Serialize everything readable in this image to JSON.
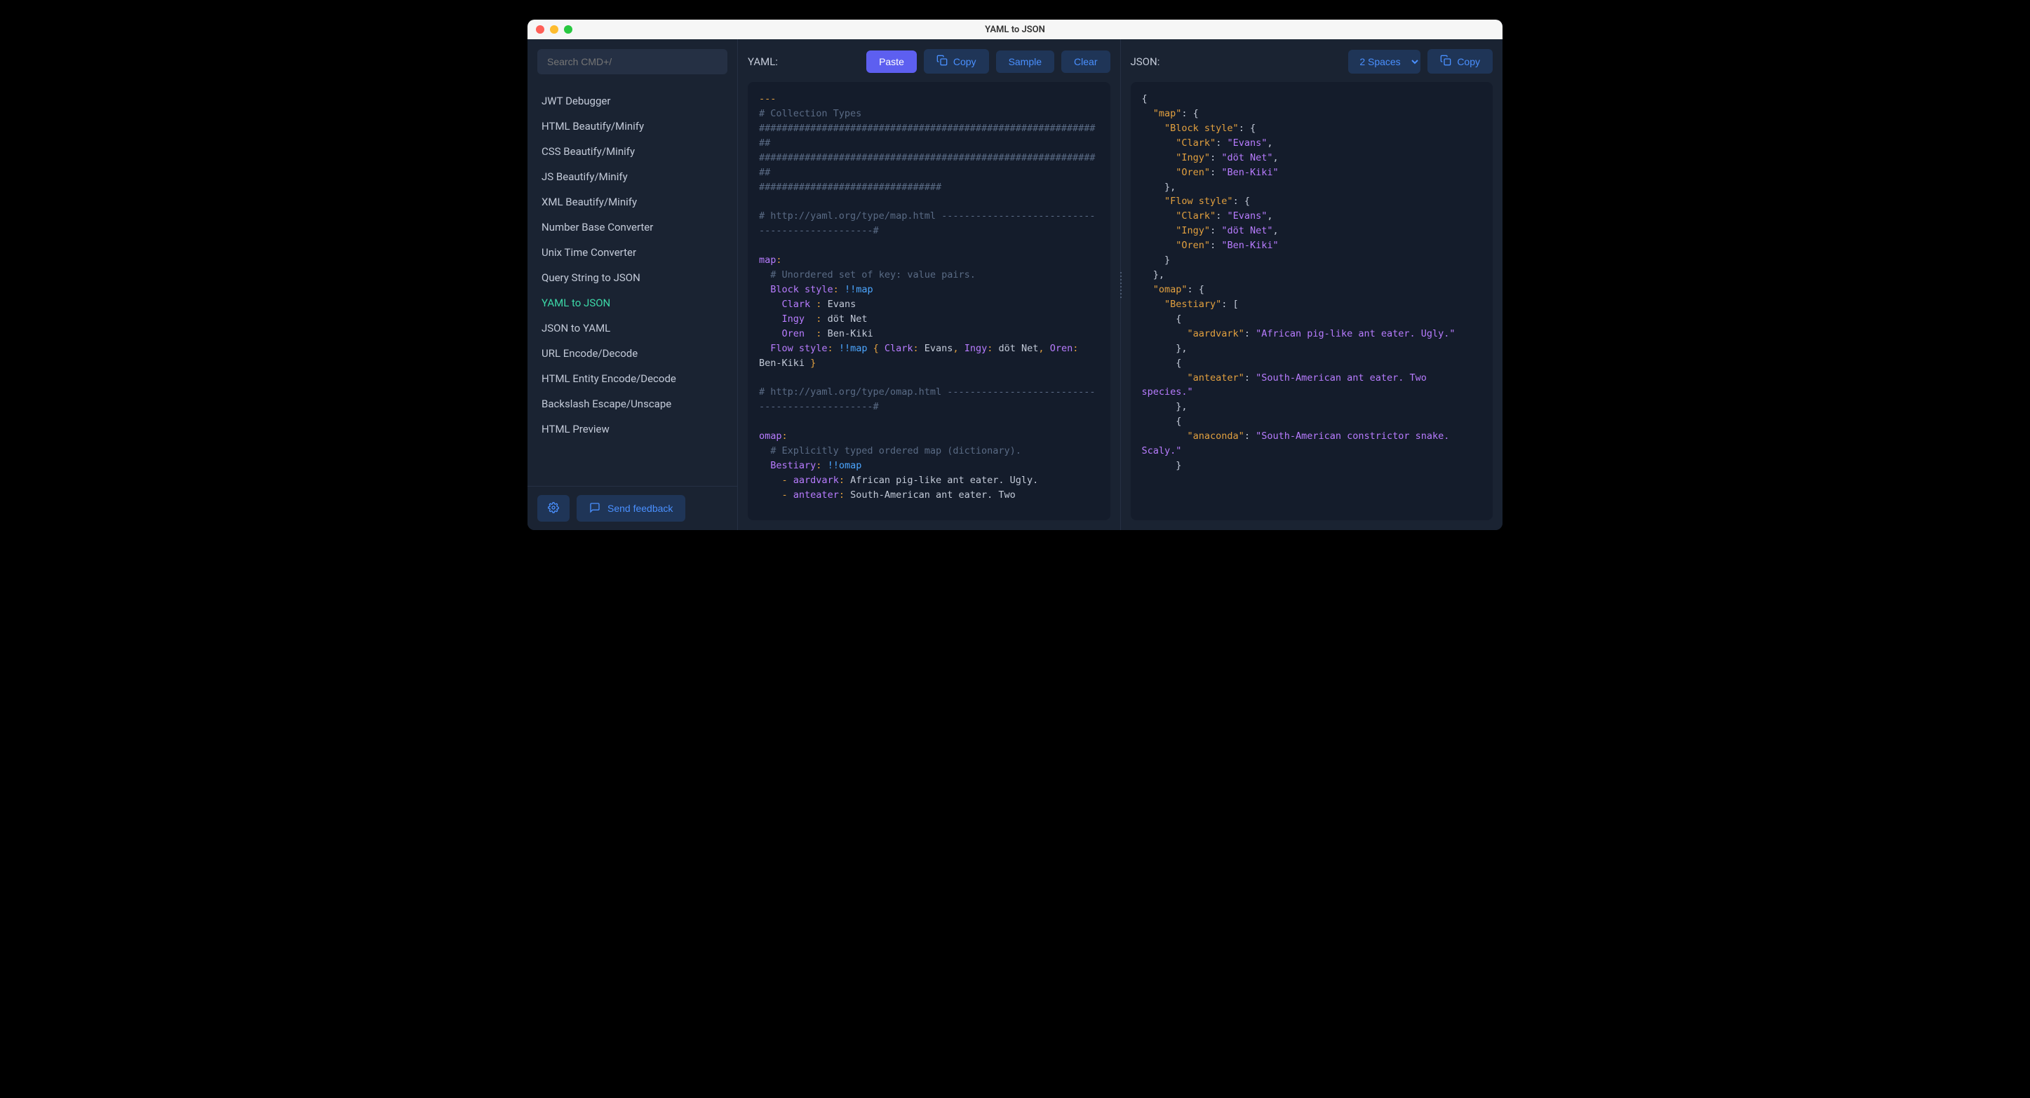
{
  "window": {
    "title": "YAML to JSON"
  },
  "search": {
    "placeholder": "Search CMD+/"
  },
  "sidebar": {
    "items": [
      {
        "label": "JWT Debugger",
        "active": false
      },
      {
        "label": "HTML Beautify/Minify",
        "active": false
      },
      {
        "label": "CSS Beautify/Minify",
        "active": false
      },
      {
        "label": "JS Beautify/Minify",
        "active": false
      },
      {
        "label": "XML Beautify/Minify",
        "active": false
      },
      {
        "label": "Number Base Converter",
        "active": false
      },
      {
        "label": "Unix Time Converter",
        "active": false
      },
      {
        "label": "Query String to JSON",
        "active": false
      },
      {
        "label": "YAML to JSON",
        "active": true
      },
      {
        "label": "JSON to YAML",
        "active": false
      },
      {
        "label": "URL Encode/Decode",
        "active": false
      },
      {
        "label": "HTML Entity Encode/Decode",
        "active": false
      },
      {
        "label": "Backslash Escape/Unscape",
        "active": false
      },
      {
        "label": "HTML Preview",
        "active": false
      }
    ],
    "feedback": "Send feedback"
  },
  "left_panel": {
    "title": "YAML:",
    "paste": "Paste",
    "copy": "Copy",
    "sample": "Sample",
    "clear": "Clear"
  },
  "right_panel": {
    "title": "JSON:",
    "spaces": "2 Spaces",
    "copy": "Copy"
  },
  "yaml_tokens": [
    {
      "c": "tok-dash",
      "t": "---"
    },
    {
      "br": true
    },
    {
      "c": "tok-comment",
      "t": "# Collection Types"
    },
    {
      "br": true
    },
    {
      "c": "tok-comment",
      "t": "#############################################################"
    },
    {
      "br": true
    },
    {
      "c": "tok-comment",
      "t": "#############################################################"
    },
    {
      "br": true
    },
    {
      "c": "tok-comment",
      "t": "################################"
    },
    {
      "br": true
    },
    {
      "br": true
    },
    {
      "c": "tok-comment",
      "t": "# http://yaml.org/type/map.html -----------------------------------------------#"
    },
    {
      "br": true
    },
    {
      "br": true
    },
    {
      "c": "tok-key",
      "t": "map"
    },
    {
      "c": "tok-punc",
      "t": ":"
    },
    {
      "br": true
    },
    {
      "t": "  "
    },
    {
      "c": "tok-comment",
      "t": "# Unordered set of key: value pairs."
    },
    {
      "br": true
    },
    {
      "t": "  "
    },
    {
      "c": "tok-key",
      "t": "Block style"
    },
    {
      "c": "tok-punc",
      "t": ":"
    },
    {
      "t": " "
    },
    {
      "c": "tok-tag",
      "t": "!!map"
    },
    {
      "br": true
    },
    {
      "t": "    "
    },
    {
      "c": "tok-key",
      "t": "Clark"
    },
    {
      "t": " "
    },
    {
      "c": "tok-punc",
      "t": ":"
    },
    {
      "t": " Evans"
    },
    {
      "br": true
    },
    {
      "t": "    "
    },
    {
      "c": "tok-key",
      "t": "Ingy"
    },
    {
      "t": "  "
    },
    {
      "c": "tok-punc",
      "t": ":"
    },
    {
      "t": " döt Net"
    },
    {
      "br": true
    },
    {
      "t": "    "
    },
    {
      "c": "tok-key",
      "t": "Oren"
    },
    {
      "t": "  "
    },
    {
      "c": "tok-punc",
      "t": ":"
    },
    {
      "t": " Ben-Kiki"
    },
    {
      "br": true
    },
    {
      "t": "  "
    },
    {
      "c": "tok-key",
      "t": "Flow style"
    },
    {
      "c": "tok-punc",
      "t": ":"
    },
    {
      "t": " "
    },
    {
      "c": "tok-tag",
      "t": "!!map"
    },
    {
      "t": " "
    },
    {
      "c": "tok-punc",
      "t": "{"
    },
    {
      "t": " "
    },
    {
      "c": "tok-key",
      "t": "Clark"
    },
    {
      "c": "tok-punc",
      "t": ":"
    },
    {
      "t": " Evans"
    },
    {
      "c": "tok-punc",
      "t": ","
    },
    {
      "t": " "
    },
    {
      "c": "tok-key",
      "t": "Ingy"
    },
    {
      "c": "tok-punc",
      "t": ":"
    },
    {
      "t": " döt Net"
    },
    {
      "c": "tok-punc",
      "t": ","
    },
    {
      "t": " "
    },
    {
      "c": "tok-key",
      "t": "Oren"
    },
    {
      "c": "tok-punc",
      "t": ":"
    },
    {
      "t": " Ben-Kiki "
    },
    {
      "c": "tok-punc",
      "t": "}"
    },
    {
      "br": true
    },
    {
      "br": true
    },
    {
      "c": "tok-comment",
      "t": "# http://yaml.org/type/omap.html ----------------------------------------------#"
    },
    {
      "br": true
    },
    {
      "br": true
    },
    {
      "c": "tok-key",
      "t": "omap"
    },
    {
      "c": "tok-punc",
      "t": ":"
    },
    {
      "br": true
    },
    {
      "t": "  "
    },
    {
      "c": "tok-comment",
      "t": "# Explicitly typed ordered map (dictionary)."
    },
    {
      "br": true
    },
    {
      "t": "  "
    },
    {
      "c": "tok-key",
      "t": "Bestiary"
    },
    {
      "c": "tok-punc",
      "t": ":"
    },
    {
      "t": " "
    },
    {
      "c": "tok-tag",
      "t": "!!omap"
    },
    {
      "br": true
    },
    {
      "t": "    "
    },
    {
      "c": "tok-punc",
      "t": "-"
    },
    {
      "t": " "
    },
    {
      "c": "tok-key",
      "t": "aardvark"
    },
    {
      "c": "tok-punc",
      "t": ":"
    },
    {
      "t": " African pig-like ant eater. Ugly."
    },
    {
      "br": true
    },
    {
      "t": "    "
    },
    {
      "c": "tok-punc",
      "t": "-"
    },
    {
      "t": " "
    },
    {
      "c": "tok-key",
      "t": "anteater"
    },
    {
      "c": "tok-punc",
      "t": ":"
    },
    {
      "t": " South-American ant eater. Two"
    }
  ],
  "json_tokens": [
    {
      "t": "{"
    },
    {
      "br": true
    },
    {
      "t": "  "
    },
    {
      "c": "tok-jkey",
      "t": "\"map\""
    },
    {
      "t": ": {"
    },
    {
      "br": true
    },
    {
      "t": "    "
    },
    {
      "c": "tok-jkey",
      "t": "\"Block style\""
    },
    {
      "t": ": {"
    },
    {
      "br": true
    },
    {
      "t": "      "
    },
    {
      "c": "tok-jkey",
      "t": "\"Clark\""
    },
    {
      "t": ": "
    },
    {
      "c": "tok-jstr",
      "t": "\"Evans\""
    },
    {
      "t": ","
    },
    {
      "br": true
    },
    {
      "t": "      "
    },
    {
      "c": "tok-jkey",
      "t": "\"Ingy\""
    },
    {
      "t": ": "
    },
    {
      "c": "tok-jstr",
      "t": "\"döt Net\""
    },
    {
      "t": ","
    },
    {
      "br": true
    },
    {
      "t": "      "
    },
    {
      "c": "tok-jkey",
      "t": "\"Oren\""
    },
    {
      "t": ": "
    },
    {
      "c": "tok-jstr",
      "t": "\"Ben-Kiki\""
    },
    {
      "br": true
    },
    {
      "t": "    },"
    },
    {
      "br": true
    },
    {
      "t": "    "
    },
    {
      "c": "tok-jkey",
      "t": "\"Flow style\""
    },
    {
      "t": ": {"
    },
    {
      "br": true
    },
    {
      "t": "      "
    },
    {
      "c": "tok-jkey",
      "t": "\"Clark\""
    },
    {
      "t": ": "
    },
    {
      "c": "tok-jstr",
      "t": "\"Evans\""
    },
    {
      "t": ","
    },
    {
      "br": true
    },
    {
      "t": "      "
    },
    {
      "c": "tok-jkey",
      "t": "\"Ingy\""
    },
    {
      "t": ": "
    },
    {
      "c": "tok-jstr",
      "t": "\"döt Net\""
    },
    {
      "t": ","
    },
    {
      "br": true
    },
    {
      "t": "      "
    },
    {
      "c": "tok-jkey",
      "t": "\"Oren\""
    },
    {
      "t": ": "
    },
    {
      "c": "tok-jstr",
      "t": "\"Ben-Kiki\""
    },
    {
      "br": true
    },
    {
      "t": "    }"
    },
    {
      "br": true
    },
    {
      "t": "  },"
    },
    {
      "br": true
    },
    {
      "t": "  "
    },
    {
      "c": "tok-jkey",
      "t": "\"omap\""
    },
    {
      "t": ": {"
    },
    {
      "br": true
    },
    {
      "t": "    "
    },
    {
      "c": "tok-jkey",
      "t": "\"Bestiary\""
    },
    {
      "t": ": ["
    },
    {
      "br": true
    },
    {
      "t": "      {"
    },
    {
      "br": true
    },
    {
      "t": "        "
    },
    {
      "c": "tok-jkey",
      "t": "\"aardvark\""
    },
    {
      "t": ": "
    },
    {
      "c": "tok-jstr",
      "t": "\"African pig-like ant eater. Ugly.\""
    },
    {
      "br": true
    },
    {
      "t": "      },"
    },
    {
      "br": true
    },
    {
      "t": "      {"
    },
    {
      "br": true
    },
    {
      "t": "        "
    },
    {
      "c": "tok-jkey",
      "t": "\"anteater\""
    },
    {
      "t": ": "
    },
    {
      "c": "tok-jstr",
      "t": "\"South-American ant eater. Two species.\""
    },
    {
      "br": true
    },
    {
      "t": "      },"
    },
    {
      "br": true
    },
    {
      "t": "      {"
    },
    {
      "br": true
    },
    {
      "t": "        "
    },
    {
      "c": "tok-jkey",
      "t": "\"anaconda\""
    },
    {
      "t": ": "
    },
    {
      "c": "tok-jstr",
      "t": "\"South-American constrictor snake. Scaly.\""
    },
    {
      "br": true
    },
    {
      "t": "      }"
    }
  ]
}
